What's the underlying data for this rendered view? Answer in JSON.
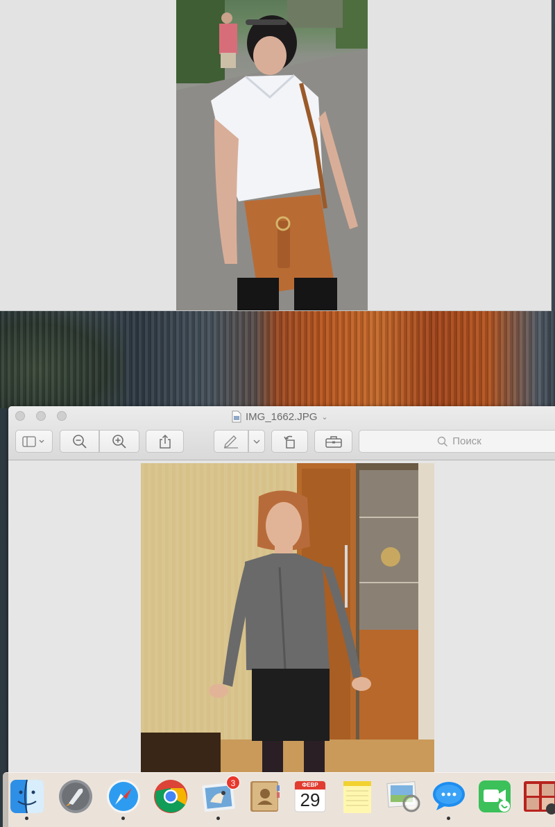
{
  "background_window": {
    "photo": "outdoor-portrait-photo"
  },
  "preview_window": {
    "title": "IMG_1662.JPG",
    "toolbar": {
      "sidebar_icon": "sidebar-toggle-icon",
      "zoom_out_icon": "zoom-out-icon",
      "zoom_in_icon": "zoom-in-icon",
      "share_icon": "share-icon",
      "markup_icon": "markup-pen-icon",
      "rotate_icon": "rotate-icon",
      "toolbox_icon": "toolbox-icon",
      "search_placeholder": "Поиск"
    },
    "photo": "indoor-portrait-photo"
  },
  "dock": {
    "items": [
      {
        "name": "Finder",
        "icon": "finder-icon",
        "running": true
      },
      {
        "name": "Launchpad",
        "icon": "launchpad-icon",
        "running": false
      },
      {
        "name": "Safari",
        "icon": "safari-icon",
        "running": true
      },
      {
        "name": "Google Chrome",
        "icon": "chrome-icon",
        "running": false
      },
      {
        "name": "Mail",
        "icon": "mail-icon",
        "running": true,
        "badge": "3"
      },
      {
        "name": "Contacts",
        "icon": "contacts-icon",
        "running": false
      },
      {
        "name": "Calendar",
        "icon": "calendar-icon",
        "running": false,
        "month": "ФЕВР",
        "day": "29"
      },
      {
        "name": "Notes",
        "icon": "notes-icon",
        "running": false
      },
      {
        "name": "Preview",
        "icon": "preview-icon",
        "running": false
      },
      {
        "name": "Messages",
        "icon": "messages-icon",
        "running": true
      },
      {
        "name": "FaceTime",
        "icon": "facetime-icon",
        "running": false
      },
      {
        "name": "Photo Booth",
        "icon": "photo-booth-icon",
        "running": false
      }
    ]
  },
  "colors": {
    "window_bg": "#e6e6e6",
    "badge_red": "#e8372c"
  }
}
